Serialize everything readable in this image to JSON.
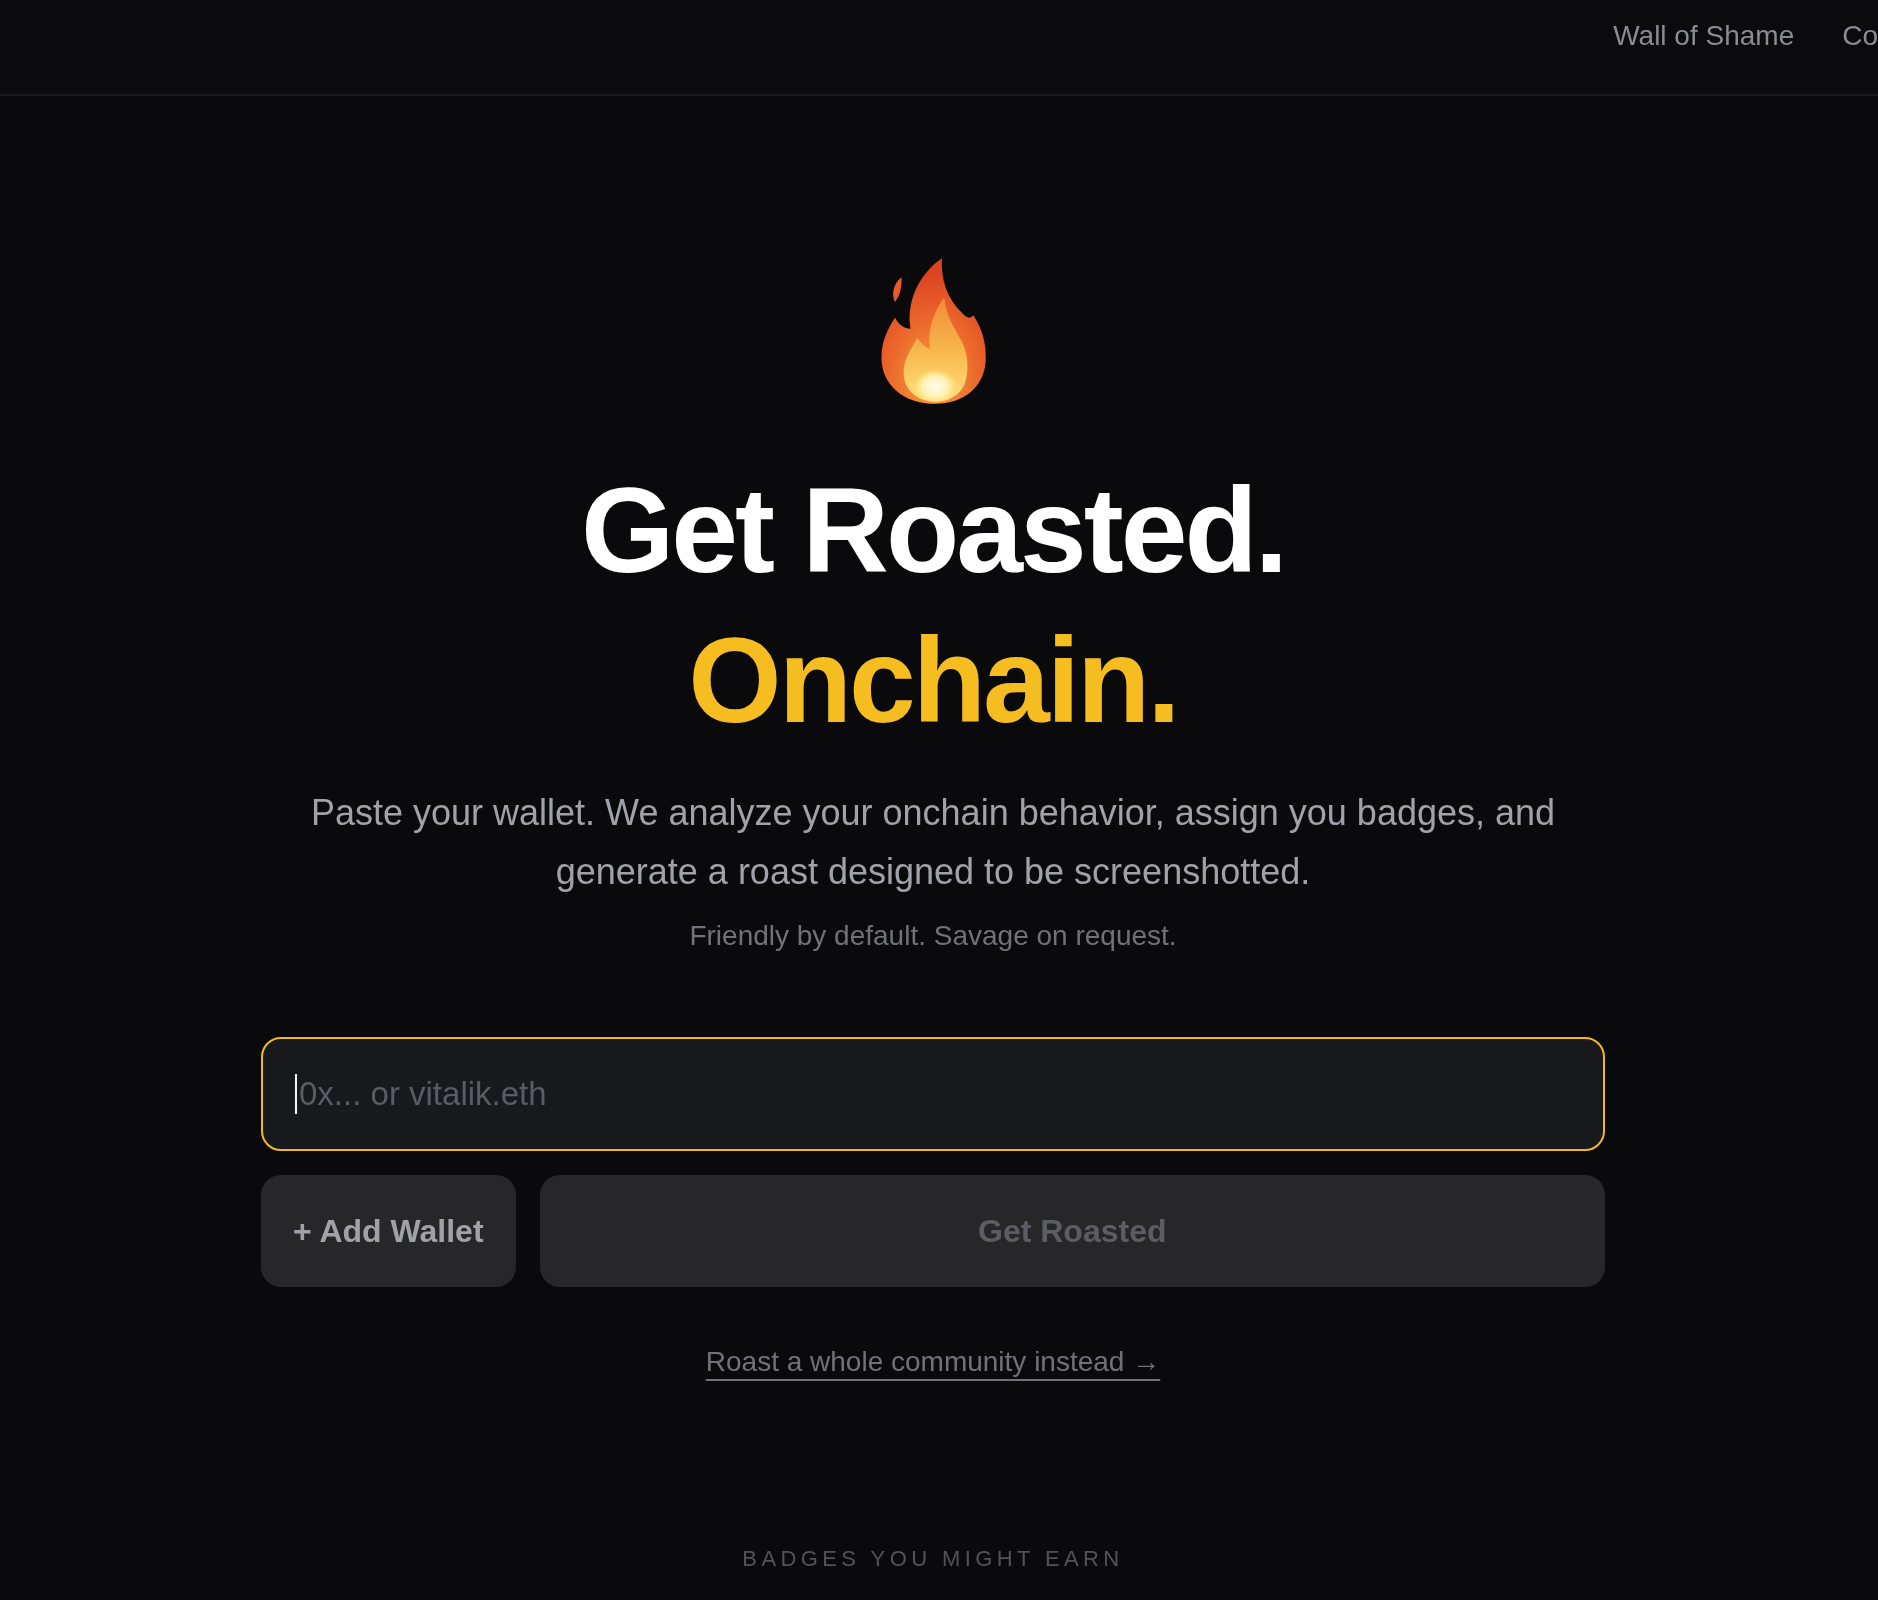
{
  "nav": {
    "links": [
      {
        "label": "Wall of Shame"
      },
      {
        "label": "Co"
      }
    ]
  },
  "hero": {
    "title_line_1": "Get Roasted.",
    "title_line_2": "Onchain.",
    "description": "Paste your wallet. We analyze your onchain behavior, assign you badges, and generate a roast designed to be screenshotted.",
    "tagline": "Friendly by default. Savage on request."
  },
  "wallet_form": {
    "input": {
      "placeholder": "0x... or vitalik.eth",
      "focused": true
    },
    "buttons": [
      {
        "label": "+ Add Wallet",
        "kind": "secondary",
        "disabled": false
      },
      {
        "label": "Get Roasted",
        "kind": "primary",
        "disabled": true
      }
    ]
  },
  "community_link": "Roast a whole community instead →",
  "badges_section": {
    "heading": "BADGES YOU MIGHT EARN"
  }
}
